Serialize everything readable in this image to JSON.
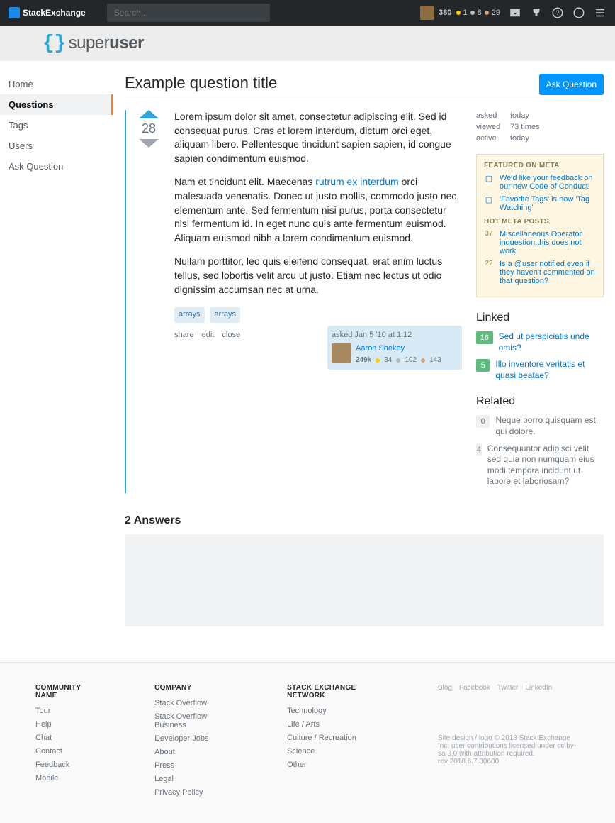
{
  "topbar": {
    "brand": "StackExchange",
    "search_placeholder": "Search...",
    "rep": "380",
    "gold": "1",
    "silver": "8",
    "bronze": "29"
  },
  "site_logo": {
    "super": "super",
    "user": "user"
  },
  "sidebar": {
    "items": [
      "Home",
      "Questions",
      "Tags",
      "Users",
      "Ask Question"
    ],
    "selected": 1
  },
  "question": {
    "title": "Example question title",
    "ask_button": "Ask Question",
    "votes": "28",
    "para1": "Lorem ipsum dolor sit amet, consectetur adipiscing elit. Sed id consequat purus. Cras et lorem interdum, dictum orci eget, aliquam libero. Pellentesque tincidunt sapien sapien, id congue sapien condimentum euismod.",
    "para2a": "Nam et tincidunt elit. Maecenas ",
    "para2link": "rutrum ex interdum",
    "para2b": " orci malesuada venenatis. Donec ut justo mollis, commodo justo nec, elementum ante. Sed fermentum nisi purus, porta consectetur nisl fermentum id. In eget nunc quis ante fermentum euismod. Aliquam euismod nibh a lorem condimentum euismod.",
    "para3": "Nullam porttitor, leo quis eleifend consequat, erat enim luctus tellus, sed lobortis velit arcu ut justo. Etiam nec lectus ut odio dignissim accumsan nec at urna.",
    "tags": [
      "arrays",
      "arrays"
    ],
    "actions": [
      "share",
      "edit",
      "close"
    ],
    "usercard": {
      "when": "asked Jan 5 '10 at 1:12",
      "name": "Aaron Shekey",
      "rep": "249k",
      "gold": "34",
      "silver": "102",
      "bronze": "143"
    }
  },
  "stats": {
    "asked_lbl": "asked",
    "asked_val": "today",
    "viewed_lbl": "viewed",
    "viewed_val": "73 times",
    "active_lbl": "active",
    "active_val": "today"
  },
  "bulletin": {
    "h1": "FEATURED ON META",
    "items1": [
      "We'd like your feedback on our new Code of Conduct!",
      "'Favorite Tags' is now 'Tag Watching'"
    ],
    "h2": "HOT META POSTS",
    "items2": [
      {
        "n": "37",
        "t": "Miscellaneous Operator inquestion:this does not work"
      },
      {
        "n": "22",
        "t": "Is a @user notified even if they haven't commented on that question?"
      }
    ]
  },
  "answers": {
    "header": "2 Answers"
  },
  "linked": {
    "header": "Linked",
    "items": [
      {
        "score": "16",
        "answered": true,
        "title": "Sed ut perspiciatis unde omis?"
      },
      {
        "score": "5",
        "answered": true,
        "title": "Illo inventore veritatis et quasi beatae?"
      }
    ]
  },
  "related": {
    "header": "Related",
    "items": [
      {
        "score": "0",
        "title": "Neque porro quisquam est, qui dolore."
      },
      {
        "score": "4",
        "title": "Consequuntor adipisci velit sed quia non numquam eius modi tempora incidunt ut labore et laboriosam?"
      }
    ]
  },
  "footer": {
    "col1": {
      "h": "COMMUNITY NAME",
      "items": [
        "Tour",
        "Help",
        "Chat",
        "Contact",
        "Feedback",
        "Mobile"
      ]
    },
    "col2": {
      "h": "COMPANY",
      "items": [
        "Stack Overflow",
        "Stack Overflow Business",
        "Developer Jobs",
        "About",
        "Press",
        "Legal",
        "Privacy Policy"
      ]
    },
    "col3": {
      "h": "STACK EXCHANGE NETWORK",
      "items": [
        "Technology",
        "Life / Arts",
        "Culture / Recreation",
        "Science",
        "Other"
      ]
    },
    "social": [
      "Blog",
      "Facebook",
      "Twitter",
      "LinkedIn"
    ],
    "legal1": "Site design / logo © 2018 Stack Exchange Inc; user contributions licensed under cc by-sa 3.0 with attribution required.",
    "legal2": "rev 2018.6.7.30680"
  }
}
